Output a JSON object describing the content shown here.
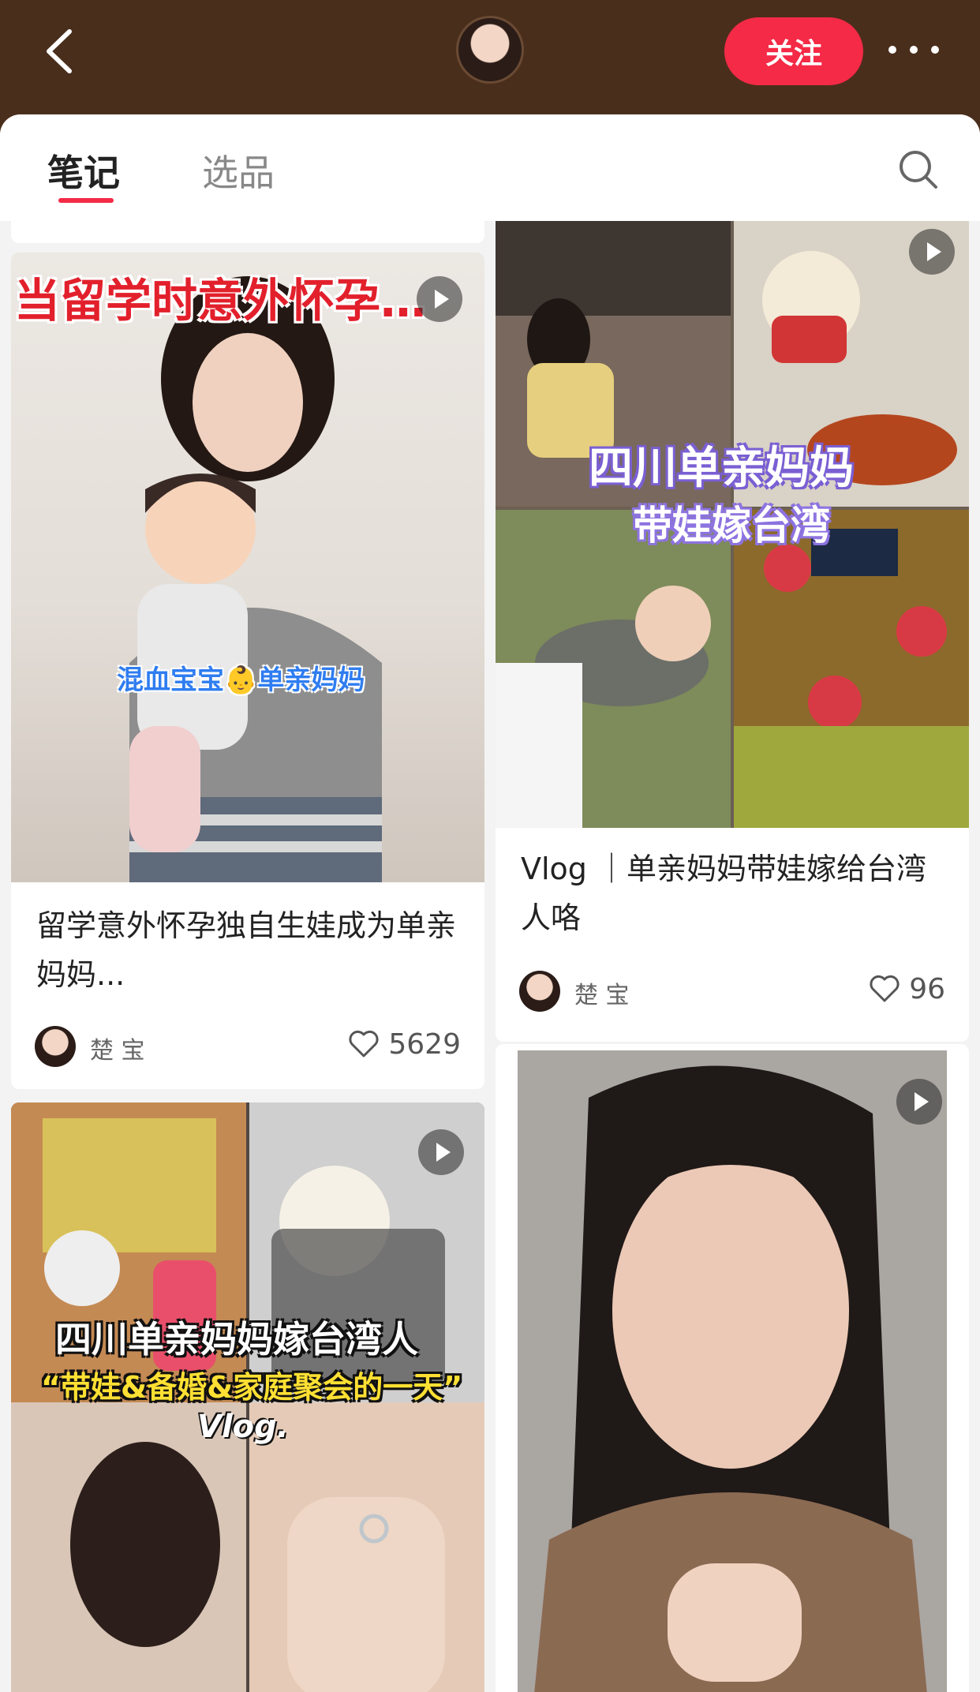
{
  "header": {
    "follow_label": "关注"
  },
  "tabs": [
    {
      "label": "笔记",
      "active": true
    },
    {
      "label": "选品",
      "active": false
    }
  ],
  "cards": [
    {
      "overlay_title": "当留学时意外怀孕…",
      "overlay_caption": "混血宝宝👶单亲妈妈",
      "title": "留学意外怀孕独自生娃成为单亲妈妈...",
      "author": "楚  宝",
      "likes": "5629"
    },
    {
      "overlay_line1": "四川单亲妈妈",
      "overlay_line2": "带娃嫁台湾",
      "title": "Vlog ｜单亲妈妈带娃嫁给台湾人咯",
      "author": "楚  宝",
      "likes": "96"
    },
    {
      "overlay_line1": "四川单亲妈妈嫁台湾人",
      "overlay_line2": "“带娃&备婚&家庭聚会的一天”",
      "overlay_line3": "Vlog."
    },
    {}
  ],
  "colors": {
    "accent": "#f42a46",
    "header_bg": "#4a2e1c"
  }
}
